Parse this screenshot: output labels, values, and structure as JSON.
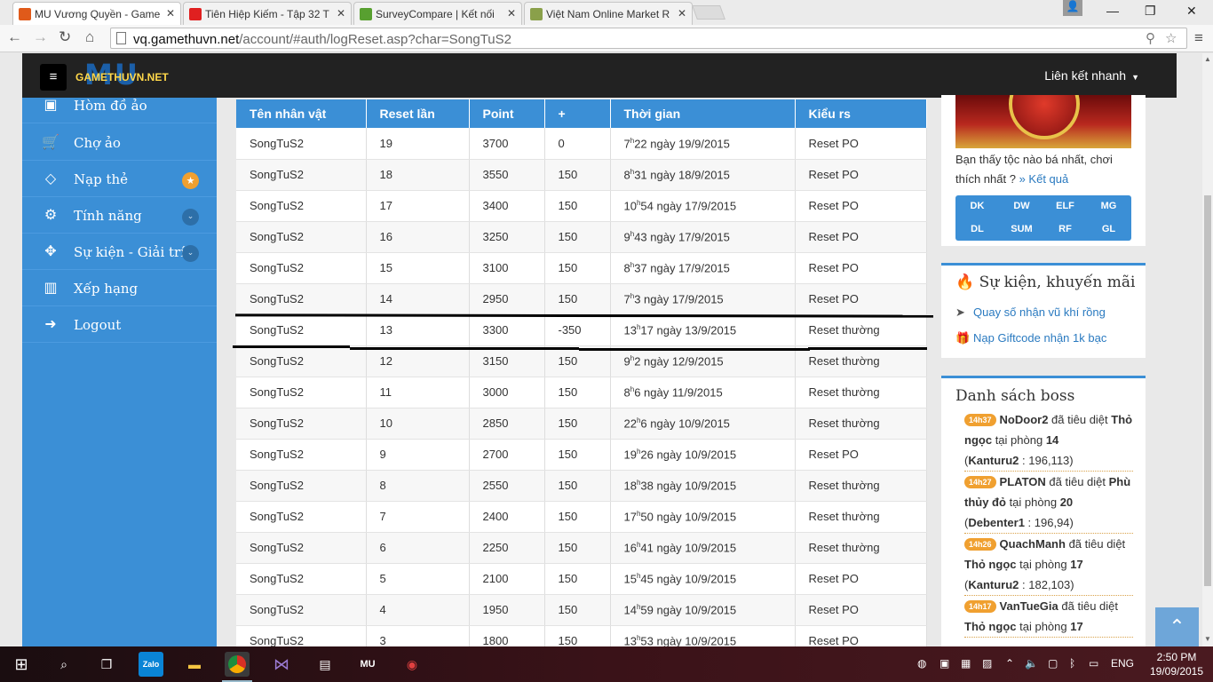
{
  "browser": {
    "tabs": [
      {
        "title": "MU Vương Quyền - Game",
        "favicon_color": "#e05a1a",
        "active": true
      },
      {
        "title": "Tiên Hiệp Kiếm - Tập 32 T",
        "favicon_color": "#e02020",
        "active": false
      },
      {
        "title": "SurveyCompare | Kết nối",
        "favicon_color": "#58a030",
        "active": false
      },
      {
        "title": "Việt Nam Online Market R",
        "favicon_color": "#8aa04a",
        "active": false
      }
    ],
    "url_host": "vq.gamethuvn.net",
    "url_path": "/account/#auth/logReset.asp?char=SongTuS2"
  },
  "header": {
    "logo_big": "MU",
    "logo_brand": "GAMETHUVN.NET",
    "quick_links": "Liên kết nhanh"
  },
  "sidebar": {
    "items": [
      {
        "label": "Hòm đồ ảo",
        "icon": "chest-icon"
      },
      {
        "label": "Chợ ảo",
        "icon": "cart-icon"
      },
      {
        "label": "Nạp thẻ",
        "icon": "diamond-icon",
        "badge": "★"
      },
      {
        "label": "Tính năng",
        "icon": "gears-icon",
        "badge": "⌄"
      },
      {
        "label": "Sự kiện - Giải trí",
        "icon": "gamepad-icon",
        "badge": "⌄"
      },
      {
        "label": "Xếp hạng",
        "icon": "bar-chart-icon"
      },
      {
        "label": "Logout",
        "icon": "logout-icon"
      }
    ]
  },
  "reset_log": {
    "columns": [
      "Tên nhân vật",
      "Reset lần",
      "Point",
      "+",
      "Thời gian",
      "Kiểu rs"
    ],
    "rows": [
      {
        "name": "SongTuS2",
        "reset": "19",
        "point": "3700",
        "plus": "0",
        "hour": "7",
        "min": "22 ngày 19/9/2015",
        "type": "Reset PO"
      },
      {
        "name": "SongTuS2",
        "reset": "18",
        "point": "3550",
        "plus": "150",
        "hour": "8",
        "min": "31 ngày 18/9/2015",
        "type": "Reset PO"
      },
      {
        "name": "SongTuS2",
        "reset": "17",
        "point": "3400",
        "plus": "150",
        "hour": "10",
        "min": "54 ngày 17/9/2015",
        "type": "Reset PO"
      },
      {
        "name": "SongTuS2",
        "reset": "16",
        "point": "3250",
        "plus": "150",
        "hour": "9",
        "min": "43 ngày 17/9/2015",
        "type": "Reset PO"
      },
      {
        "name": "SongTuS2",
        "reset": "15",
        "point": "3100",
        "plus": "150",
        "hour": "8",
        "min": "37 ngày 17/9/2015",
        "type": "Reset PO"
      },
      {
        "name": "SongTuS2",
        "reset": "14",
        "point": "2950",
        "plus": "150",
        "hour": "7",
        "min": "3 ngày 17/9/2015",
        "type": "Reset PO"
      },
      {
        "name": "SongTuS2",
        "reset": "13",
        "point": "3300",
        "plus": "-350",
        "hour": "13",
        "min": "17 ngày 13/9/2015",
        "type": "Reset thường"
      },
      {
        "name": "SongTuS2",
        "reset": "12",
        "point": "3150",
        "plus": "150",
        "hour": "9",
        "min": "2 ngày 12/9/2015",
        "type": "Reset thường"
      },
      {
        "name": "SongTuS2",
        "reset": "11",
        "point": "3000",
        "plus": "150",
        "hour": "8",
        "min": "6 ngày 11/9/2015",
        "type": "Reset thường"
      },
      {
        "name": "SongTuS2",
        "reset": "10",
        "point": "2850",
        "plus": "150",
        "hour": "22",
        "min": "6 ngày 10/9/2015",
        "type": "Reset thường"
      },
      {
        "name": "SongTuS2",
        "reset": "9",
        "point": "2700",
        "plus": "150",
        "hour": "19",
        "min": "26 ngày 10/9/2015",
        "type": "Reset PO"
      },
      {
        "name": "SongTuS2",
        "reset": "8",
        "point": "2550",
        "plus": "150",
        "hour": "18",
        "min": "38 ngày 10/9/2015",
        "type": "Reset thường"
      },
      {
        "name": "SongTuS2",
        "reset": "7",
        "point": "2400",
        "plus": "150",
        "hour": "17",
        "min": "50 ngày 10/9/2015",
        "type": "Reset thường"
      },
      {
        "name": "SongTuS2",
        "reset": "6",
        "point": "2250",
        "plus": "150",
        "hour": "16",
        "min": "41 ngày 10/9/2015",
        "type": "Reset thường"
      },
      {
        "name": "SongTuS2",
        "reset": "5",
        "point": "2100",
        "plus": "150",
        "hour": "15",
        "min": "45 ngày 10/9/2015",
        "type": "Reset PO"
      },
      {
        "name": "SongTuS2",
        "reset": "4",
        "point": "1950",
        "plus": "150",
        "hour": "14",
        "min": "59 ngày 10/9/2015",
        "type": "Reset PO"
      },
      {
        "name": "SongTuS2",
        "reset": "3",
        "point": "1800",
        "plus": "150",
        "hour": "13",
        "min": "53 ngày 10/9/2015",
        "type": "Reset PO"
      }
    ],
    "hour_suffix": "h"
  },
  "poll": {
    "question": "Bạn thấy tộc nào bá nhất, chơi thích nhất ?",
    "result_link": "» Kết quả",
    "classes": [
      "DK",
      "DW",
      "ELF",
      "MG",
      "DL",
      "SUM",
      "RF",
      "GL"
    ]
  },
  "events": {
    "title": "Sự kiện, khuyến mãi",
    "items": [
      {
        "label": "Quay số nhận vũ khí rồng",
        "icon": "cursor-icon"
      },
      {
        "label": "Nạp Giftcode nhận 1k bạc",
        "icon": "gift-icon"
      }
    ]
  },
  "bosses": {
    "title": "Danh sách boss",
    "killed_text": "đã tiêu diệt",
    "at_room": "tại phòng",
    "entries": [
      {
        "time": "14h37",
        "killer": "NoDoor2",
        "boss": "Thỏ ngọc",
        "room": "14",
        "map": "Kanturu2",
        "coords": ": 196,113)"
      },
      {
        "time": "14h27",
        "killer": "PLATON",
        "boss": "Phù thủy đỏ",
        "room": "20",
        "map": "Debenter1",
        "coords": ": 196,94)"
      },
      {
        "time": "14h26",
        "killer": "QuachManh",
        "boss": "Thỏ ngọc",
        "room": "17",
        "map": "Kanturu2",
        "coords": ": 182,103)"
      },
      {
        "time": "14h17",
        "killer": "VanTueGia",
        "boss": "Thỏ ngọc",
        "room": "17",
        "map": "",
        "coords": ""
      }
    ]
  },
  "taskbar": {
    "language": "ENG",
    "time": "2:50 PM",
    "date": "19/09/2015"
  },
  "colors": {
    "accent": "#3b8fd6",
    "topnav": "#222222",
    "badge": "#f0a030"
  }
}
